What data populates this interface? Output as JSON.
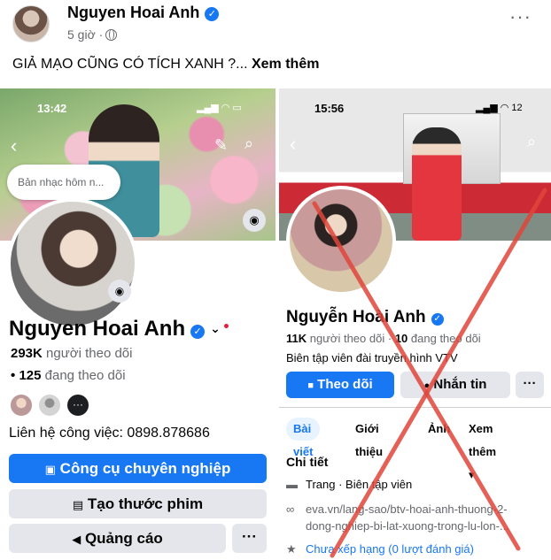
{
  "post": {
    "author": "Nguyen Hoai Anh",
    "time": "5 giờ ·",
    "text": "GIẢ MẠO CŨNG CÓ TÍCH XANH ?...",
    "see_more": "Xem thêm"
  },
  "left": {
    "status_time": "13:42",
    "status_icons": "▂▄▆ ◠ ▭",
    "bubble_text": "Bản nhạc hôm n...",
    "name": "Nguyen Hoai Anh",
    "followers_count": "293K",
    "followers_label": "người theo dõi",
    "following_prefix": "•",
    "following_count": "125",
    "following_label": "đang theo dõi",
    "more_friends": "···",
    "contact": "Liên hệ công việc: 0898.878686",
    "btn_tools": "Công cụ chuyên nghiệp",
    "btn_reel": "Tạo thước phim",
    "btn_ads": "Quảng cáo",
    "btn_more": "···",
    "icons": [
      "back-chevron",
      "pencil",
      "search",
      "camera",
      "camera",
      "chevron-down",
      "professional-tools",
      "reel",
      "megaphone"
    ]
  },
  "right": {
    "status_time": "15:56",
    "status_icons": "▂▄▆ ◠ 12",
    "name": "Nguyễn Hoài Anh",
    "followers_count": "11K",
    "followers_label": "người theo dõi",
    "following_prefix": "·",
    "following_count": "10",
    "following_label": "đang theo dõi",
    "bio": "Biên tập viên đài truyền hình VTV",
    "btn_follow": "Theo dõi",
    "btn_message": "Nhắn tin",
    "btn_more": "···",
    "tabs": [
      "Bài viết",
      "Giới thiệu",
      "Ảnh",
      "Xem thêm ▾"
    ],
    "details_title": "Chi tiết",
    "detail_page": "Trang · Biên tập viên",
    "detail_link_1": "eva.vn/lang-sao/btv-hoai-anh-thuong-2-",
    "detail_link_2": "dong-nghiep-bi-lat-xuong-trong-lu-lon-...",
    "detail_rating": "Chưa xếp hạng (0 lượt đánh giá)"
  },
  "colors": {
    "accent": "#1877f2",
    "secondary_button": "#e4e6eb",
    "cross": "#e0463c"
  }
}
